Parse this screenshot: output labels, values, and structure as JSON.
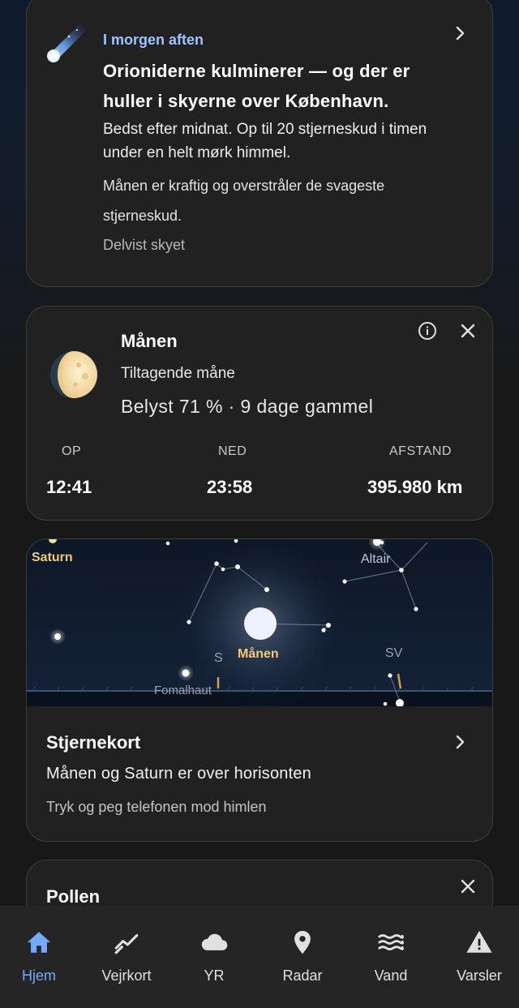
{
  "meteor_card": {
    "eyebrow": "I morgen aften",
    "headline": "Orioniderne kulminerer — og der er huller i skyerne over København.",
    "body1": "Bedst efter midnat. Op til 20 stjerneskud i timen under en helt mørk himmel.",
    "body2": "Månen er kraftig og overstråler de svageste stjerneskud.",
    "condition": "Delvist skyet",
    "icon": "meteor-icon"
  },
  "moon_card": {
    "title": "Månen",
    "phase": "Tiltagende måne",
    "illumination": "Belyst 71 % · 9 dage gammel",
    "stats": [
      {
        "label": "OP",
        "value": "12:41"
      },
      {
        "label": "NED",
        "value": "23:58"
      },
      {
        "label": "AFSTAND",
        "value": "395.980 km"
      }
    ],
    "icons": [
      "moon-icon",
      "info-icon",
      "close-icon"
    ]
  },
  "star_card": {
    "labels": {
      "saturn": "Saturn",
      "altair": "Altair",
      "moon": "Månen",
      "south": "S",
      "southwest": "SV",
      "fomalhaut": "Fomalhaut"
    },
    "title": "Stjernekort",
    "subtitle": "Månen og Saturn er over horisonten",
    "hint": "Tryk og peg telefonen mod himlen"
  },
  "pollen_card": {
    "title": "Pollen"
  },
  "nav": {
    "items": [
      {
        "label": "Hjem",
        "icon": "home-icon",
        "active": true
      },
      {
        "label": "Vejrkort",
        "icon": "trend-icon",
        "active": false
      },
      {
        "label": "YR",
        "icon": "cloud-icon",
        "active": false
      },
      {
        "label": "Radar",
        "icon": "location-pin-icon",
        "active": false
      },
      {
        "label": "Vand",
        "icon": "waves-icon",
        "active": false
      },
      {
        "label": "Varsler",
        "icon": "warning-icon",
        "active": false
      }
    ]
  },
  "colors": {
    "accent": "#74a9ff",
    "eyebrow": "#9ec3ff",
    "card_bg": "#212121",
    "sky_bg": "#0f1a2c",
    "moon_label": "#f0c878",
    "compass": "#c8a050"
  }
}
